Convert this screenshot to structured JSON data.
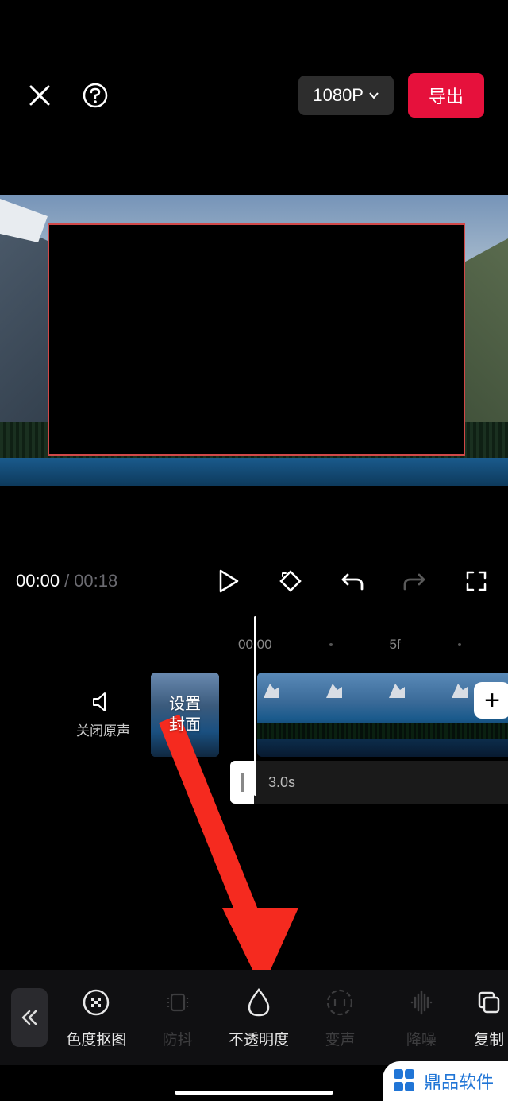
{
  "header": {
    "resolution": "1080P",
    "export_label": "导出"
  },
  "transport": {
    "current": "00:00",
    "separator": "/",
    "duration": "00:18"
  },
  "ruler": {
    "t0": "00:00",
    "t1": "5f"
  },
  "timeline": {
    "mute_label": "关闭原声",
    "cover_label": "设置\n封面",
    "audio_duration": "3.0s"
  },
  "tools": {
    "chroma": "色度抠图",
    "stabilize": "防抖",
    "opacity": "不透明度",
    "voice": "变声",
    "denoise": "降噪",
    "copy": "复制"
  },
  "watermark": {
    "text": "鼎品软件"
  },
  "colors": {
    "accent": "#e6113c"
  }
}
